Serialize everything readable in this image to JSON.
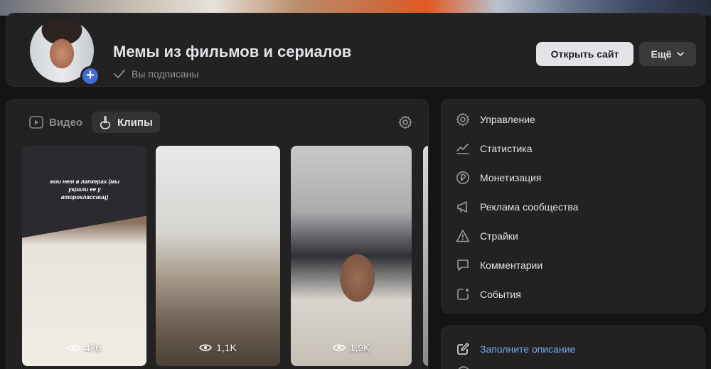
{
  "header": {
    "title": "Мемы из фильмов и сериалов",
    "subscription_status": "Вы подписаны",
    "open_site_label": "Открыть сайт",
    "more_label": "Ещё"
  },
  "clips_panel": {
    "tabs": [
      {
        "label": "Видео",
        "icon": "play-icon",
        "active": false
      },
      {
        "label": "Клипы",
        "icon": "clips-icon",
        "active": true
      }
    ],
    "clips": [
      {
        "caption": "мои нет в лапкерах (мы украли ее у второклассниц)",
        "views": "476"
      },
      {
        "caption": "",
        "views": "1,1K"
      },
      {
        "caption": "",
        "views": "1,9K"
      }
    ]
  },
  "sidebar_menu": {
    "items": [
      {
        "label": "Управление",
        "icon": "gear-icon"
      },
      {
        "label": "Статистика",
        "icon": "chart-icon"
      },
      {
        "label": "Монетизация",
        "icon": "ruble-icon"
      },
      {
        "label": "Реклама сообщества",
        "icon": "megaphone-icon"
      },
      {
        "label": "Страйки",
        "icon": "warning-icon"
      },
      {
        "label": "Комментарии",
        "icon": "comment-icon"
      },
      {
        "label": "События",
        "icon": "event-icon"
      }
    ]
  },
  "description_prompt": {
    "label": "Заполните описание",
    "icon": "edit-icon"
  },
  "colors": {
    "background": "#141414",
    "card": "#222222",
    "accent_link": "#71aaeb",
    "add_badge": "#3f6fd0"
  }
}
